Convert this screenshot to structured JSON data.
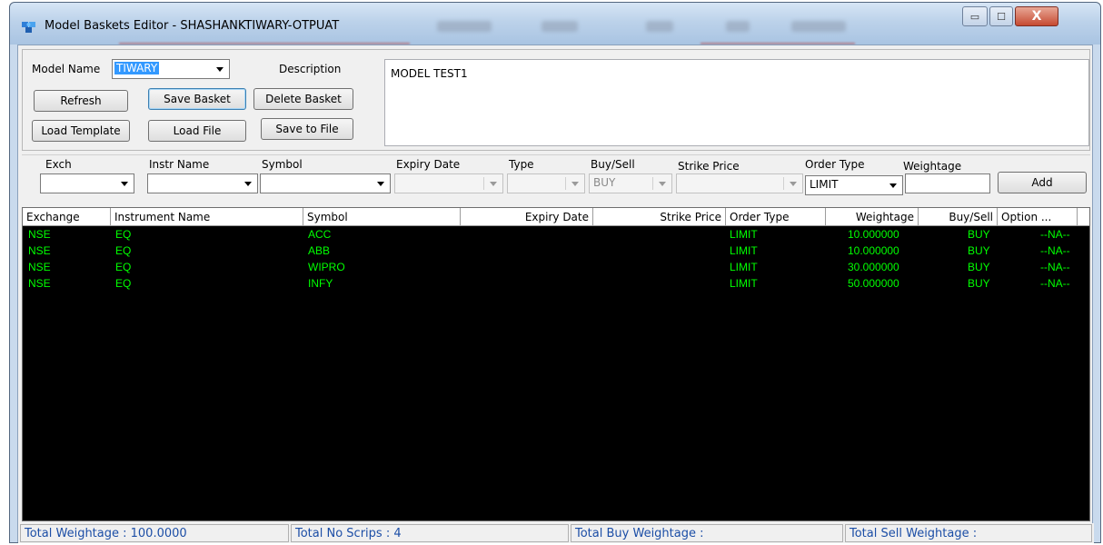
{
  "window": {
    "title": "Model Baskets Editor - SHASHANKTIWARY-OTPUAT",
    "controls": {
      "minimize": "▭",
      "maximize": "☐",
      "close": "X"
    }
  },
  "model": {
    "name_label": "Model Name",
    "name_value": "TIWARY",
    "description_label": "Description",
    "description_value": "MODEL TEST1"
  },
  "buttons": {
    "refresh": "Refresh",
    "save_basket": "Save Basket",
    "delete_basket": "Delete Basket",
    "load_template": "Load Template",
    "load_file": "Load File",
    "save_to_file": "Save to File",
    "add": "Add"
  },
  "entry": {
    "labels": {
      "exch": "Exch",
      "instr_name": "Instr Name",
      "symbol": "Symbol",
      "expiry_date": "Expiry Date",
      "type": "Type",
      "buy_sell": "Buy/Sell",
      "strike_price": "Strike Price",
      "order_type": "Order Type",
      "weightage": "Weightage"
    },
    "values": {
      "buy_sell": "BUY",
      "order_type": "LIMIT"
    }
  },
  "grid": {
    "columns": [
      "Exchange",
      "Instrument Name",
      "Symbol",
      "Expiry Date",
      "Strike Price",
      "Order Type",
      "Weightage",
      "Buy/Sell",
      "Option ..."
    ],
    "rows": [
      {
        "exchange": "NSE",
        "instrument": "EQ",
        "symbol": "ACC",
        "expiry": "",
        "strike": "",
        "order_type": "LIMIT",
        "weightage": "10.000000",
        "buy_sell": "BUY",
        "option": "--NA--"
      },
      {
        "exchange": "NSE",
        "instrument": "EQ",
        "symbol": "ABB",
        "expiry": "",
        "strike": "",
        "order_type": "LIMIT",
        "weightage": "10.000000",
        "buy_sell": "BUY",
        "option": "--NA--"
      },
      {
        "exchange": "NSE",
        "instrument": "EQ",
        "symbol": "WIPRO",
        "expiry": "",
        "strike": "",
        "order_type": "LIMIT",
        "weightage": "30.000000",
        "buy_sell": "BUY",
        "option": "--NA--"
      },
      {
        "exchange": "NSE",
        "instrument": "EQ",
        "symbol": "INFY",
        "expiry": "",
        "strike": "",
        "order_type": "LIMIT",
        "weightage": "50.000000",
        "buy_sell": "BUY",
        "option": "--NA--"
      }
    ]
  },
  "status": {
    "total_weightage": "Total Weightage : 100.0000",
    "total_scrips": "Total No Scrips : 4",
    "total_buy": "Total Buy Weightage :",
    "total_sell": "Total Sell Weightage :"
  },
  "colors": {
    "grid_background": "#000000",
    "grid_text": "#00ff00",
    "status_text": "#1c4ea6"
  }
}
